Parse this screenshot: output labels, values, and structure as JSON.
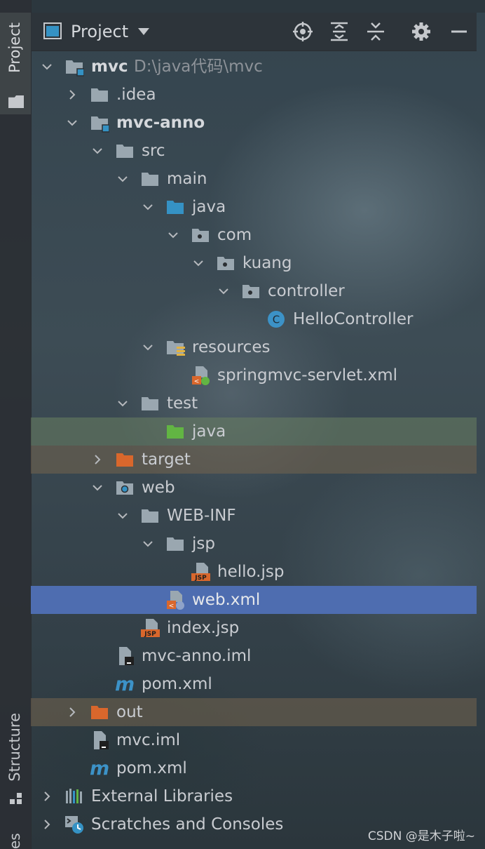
{
  "toolbar": {
    "title": "Project",
    "side_tabs": {
      "project": "Project",
      "structure": "Structure",
      "bottom": "es"
    }
  },
  "tree": {
    "mvc": {
      "label": "mvc",
      "path": "D:\\java代码\\mvc"
    },
    "idea": "idea_label",
    "rows": [
      "mvc",
      ".idea",
      "mvc-anno",
      "src",
      "main",
      "java",
      "com",
      "kuang",
      "controller",
      "HelloController",
      "resources",
      "springmvc-servlet.xml",
      "test",
      "java",
      "target",
      "web",
      "WEB-INF",
      "jsp",
      "hello.jsp",
      "web.xml",
      "index.jsp",
      "mvc-anno.iml",
      "pom.xml",
      "out",
      "mvc.iml",
      "pom.xml",
      "External Libraries",
      "Scratches and Consoles"
    ]
  },
  "labels": {
    "idea": ".idea",
    "mvc_anno": "mvc-anno",
    "src": "src",
    "main": "main",
    "java": "java",
    "com": "com",
    "kuang": "kuang",
    "controller": "controller",
    "hello_controller": "HelloController",
    "resources": "resources",
    "springmvc_xml": "springmvc-servlet.xml",
    "test": "test",
    "test_java": "java",
    "target": "target",
    "web": "web",
    "web_inf": "WEB-INF",
    "jsp": "jsp",
    "hello_jsp": "hello.jsp",
    "web_xml": "web.xml",
    "index_jsp": "index.jsp",
    "mvc_anno_iml": "mvc-anno.iml",
    "anno_pom": "pom.xml",
    "out": "out",
    "mvc_iml": "mvc.iml",
    "root_pom": "pom.xml",
    "external_libraries": "External Libraries",
    "scratches": "Scratches and Consoles",
    "jsp_badge": "JSP"
  },
  "icons": {
    "folder": "folder-icon",
    "module": "module-folder-icon",
    "source_root": "source-root-icon",
    "package": "package-icon",
    "class": "class-icon",
    "xml": "xml-file-icon",
    "jsp": "jsp-file-icon",
    "iml": "iml-file-icon",
    "maven": "maven-icon"
  },
  "colors": {
    "selection": "#4e6db0",
    "folder": "#9aa7b0",
    "source_root": "#3592c4",
    "test_root": "#62b543",
    "excluded": "#d9672c",
    "class_icon": "#3c92c7"
  },
  "watermark": "CSDN @是木子啦~"
}
